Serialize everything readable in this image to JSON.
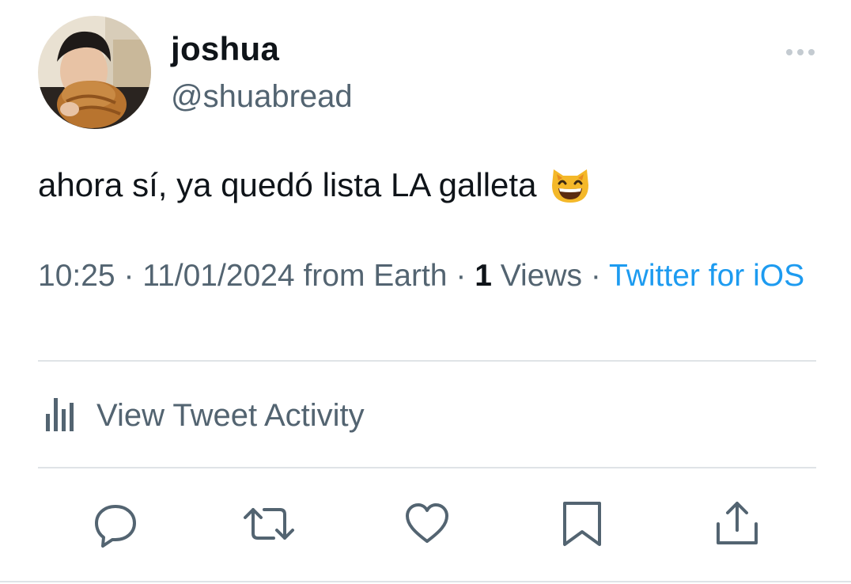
{
  "tweet": {
    "author": {
      "name": "joshua",
      "handle": "@shuabread"
    },
    "text": "ahora sí, ya quedó lista LA galleta",
    "emoji": "grinning-cat-emoji",
    "meta": {
      "time": "10:25",
      "date": "11/01/2024",
      "location": "from Earth",
      "views_count": "1",
      "views_label": "Views",
      "separator": "·",
      "source": "Twitter for iOS"
    },
    "activity_label": "View Tweet Activity"
  },
  "actions": [
    "reply-icon",
    "retweet-icon",
    "like-icon",
    "bookmark-icon",
    "share-icon"
  ],
  "colors": {
    "text_primary": "#0f1419",
    "text_secondary": "#536471",
    "accent": "#1d9bf0",
    "divider": "#dfe3e7"
  }
}
